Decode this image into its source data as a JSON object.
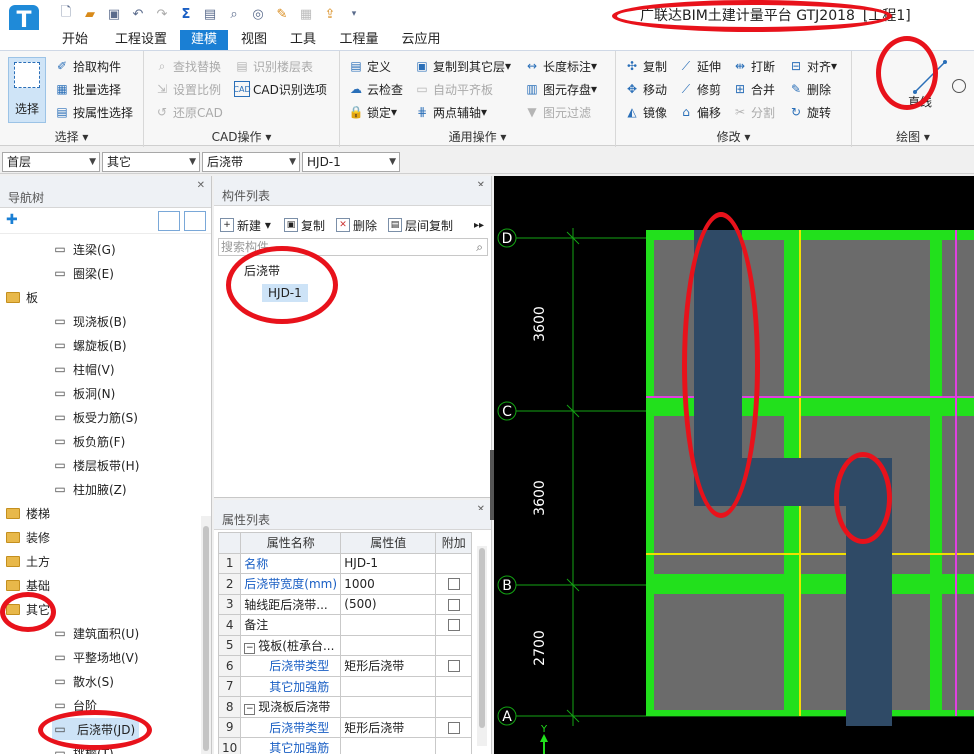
{
  "app": {
    "logo": "T",
    "title": "广联达BIM土建计量平台 GTJ2018",
    "project": "[工程1]"
  },
  "quick_access": {
    "icons": [
      "new-file-icon",
      "open-folder-icon",
      "save-icon",
      "undo-icon",
      "redo-icon",
      "sum-icon",
      "report-icon",
      "find-icon",
      "view-icon",
      "edit-icon",
      "grid-icon",
      "export-icon",
      "more-icon"
    ]
  },
  "menu": {
    "tabs": [
      "开始",
      "工程设置",
      "建模",
      "视图",
      "工具",
      "工程量",
      "云应用"
    ],
    "active_tab": "建模"
  },
  "ribbon": {
    "select_group": {
      "label": "选择",
      "big_button": "选择",
      "items": [
        "拾取构件",
        "批量选择",
        "按属性选择"
      ]
    },
    "cad_group": {
      "label": "CAD操作",
      "items": [
        "查找替换",
        "识别楼层表",
        "设置比例",
        "CAD识别选项",
        "还原CAD"
      ]
    },
    "general_group": {
      "label": "通用操作",
      "items": [
        "定义",
        "复制到其它层",
        "长度标注",
        "云检查",
        "自动平齐板",
        "图元存盘",
        "锁定",
        "两点辅轴",
        "图元过滤"
      ]
    },
    "modify_group": {
      "label": "修改",
      "items": [
        "复制",
        "延伸",
        "打断",
        "对齐",
        "移动",
        "修剪",
        "合并",
        "删除",
        "镜像",
        "偏移",
        "分割",
        "旋转"
      ]
    },
    "draw_group": {
      "label": "绘图",
      "items": [
        "直线"
      ]
    }
  },
  "selectors": {
    "floor": "首层",
    "category": "其它",
    "type": "后浇带",
    "component": "HJD-1"
  },
  "nav_tree": {
    "title": "导航树",
    "items": [
      {
        "label": "连梁(G)",
        "kind": "leaf",
        "icon": "coupling-beam-icon"
      },
      {
        "label": "圈梁(E)",
        "kind": "leaf",
        "icon": "ring-beam-icon"
      },
      {
        "label": "板",
        "kind": "folder"
      },
      {
        "label": "现浇板(B)",
        "kind": "leaf",
        "icon": "cast-slab-icon"
      },
      {
        "label": "螺旋板(B)",
        "kind": "leaf",
        "icon": "spiral-slab-icon"
      },
      {
        "label": "柱帽(V)",
        "kind": "leaf",
        "icon": "column-cap-icon"
      },
      {
        "label": "板洞(N)",
        "kind": "leaf",
        "icon": "slab-hole-icon"
      },
      {
        "label": "板受力筋(S)",
        "kind": "leaf",
        "icon": "slab-rebar-icon"
      },
      {
        "label": "板负筋(F)",
        "kind": "leaf",
        "icon": "negative-rebar-icon"
      },
      {
        "label": "楼层板带(H)",
        "kind": "leaf",
        "icon": "slab-strip-icon"
      },
      {
        "label": "柱加腋(Z)",
        "kind": "leaf",
        "icon": "column-haunch-icon"
      },
      {
        "label": "楼梯",
        "kind": "folder"
      },
      {
        "label": "装修",
        "kind": "folder"
      },
      {
        "label": "土方",
        "kind": "folder"
      },
      {
        "label": "基础",
        "kind": "folder"
      },
      {
        "label": "其它",
        "kind": "folder"
      },
      {
        "label": "建筑面积(U)",
        "kind": "leaf",
        "icon": "building-area-icon"
      },
      {
        "label": "平整场地(V)",
        "kind": "leaf",
        "icon": "site-leveling-icon"
      },
      {
        "label": "散水(S)",
        "kind": "leaf",
        "icon": "apron-icon"
      },
      {
        "label": "台阶",
        "kind": "leaf",
        "icon": "steps-icon"
      },
      {
        "label": "后浇带(JD)",
        "kind": "leaf",
        "icon": "post-cast-strip-icon",
        "selected": true
      },
      {
        "label": "挑檐(T)",
        "kind": "leaf",
        "icon": "eave-icon"
      }
    ]
  },
  "component_list": {
    "title": "构件列表",
    "toolbar": [
      "新建",
      "复制",
      "删除",
      "层间复制"
    ],
    "search_placeholder": "搜索构件...",
    "tree": {
      "group": "后浇带",
      "item": "HJD-1"
    }
  },
  "property_list": {
    "title": "属性列表",
    "headers": [
      "属性名称",
      "属性值",
      "附加"
    ],
    "rows": [
      {
        "no": "1",
        "name": "名称",
        "value": "HJD-1",
        "blue": true,
        "check": false
      },
      {
        "no": "2",
        "name": "后浇带宽度(mm)",
        "value": "1000",
        "blue": true,
        "check": true
      },
      {
        "no": "3",
        "name": "轴线距后浇带...",
        "value": "(500)",
        "blue": false,
        "check": true
      },
      {
        "no": "4",
        "name": "备注",
        "value": "",
        "blue": false,
        "check": true
      },
      {
        "no": "5",
        "name": "筏板(桩承台...",
        "value": "",
        "blue": false,
        "check": false,
        "expander": "−"
      },
      {
        "no": "6",
        "name": "后浇带类型",
        "value": "矩形后浇带",
        "blue": true,
        "check": true,
        "indent": true
      },
      {
        "no": "7",
        "name": "其它加强筋",
        "value": "",
        "blue": true,
        "check": false,
        "indent": true
      },
      {
        "no": "8",
        "name": "现浇板后浇带",
        "value": "",
        "blue": false,
        "check": false,
        "expander": "−"
      },
      {
        "no": "9",
        "name": "后浇带类型",
        "value": "矩形后浇带",
        "blue": true,
        "check": true,
        "indent": true
      },
      {
        "no": "10",
        "name": "其它加强筋",
        "value": "",
        "blue": true,
        "check": false,
        "indent": true
      }
    ]
  },
  "canvas": {
    "axes": [
      "D",
      "C",
      "B",
      "A"
    ],
    "dimensions": [
      "3600",
      "3600",
      "2700"
    ],
    "y_marker": "Y",
    "colors": {
      "background": "#000000",
      "beam": "#22e01c",
      "slab": "#6b6b6b",
      "strip": "#2f4a66",
      "magenta_line": "#e040e0",
      "yellow_line": "#f0e000",
      "axis_line": "#13a313"
    }
  }
}
